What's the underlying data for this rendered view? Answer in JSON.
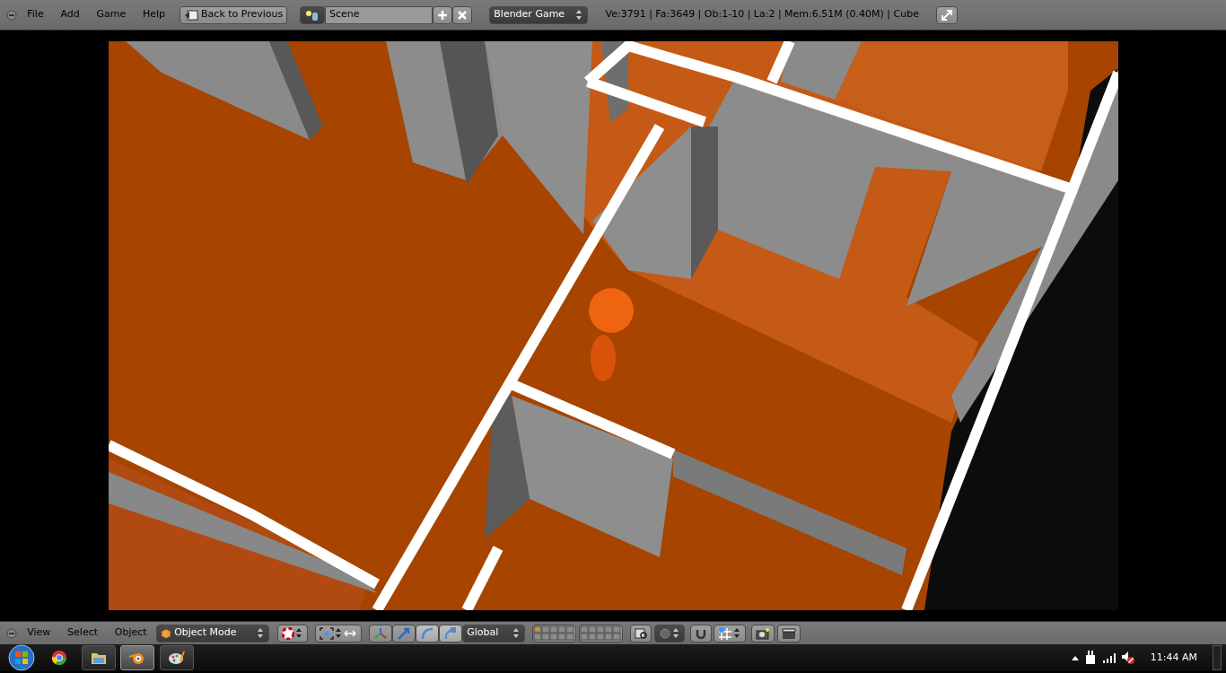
{
  "top_bar": {
    "menus": [
      "File",
      "Add",
      "Game",
      "Help"
    ],
    "back_button": "Back to Previous",
    "scene_field": "Scene",
    "render_engine": "Blender Game",
    "stats": "Ve:3791 | Fa:3649 | Ob:1-10 | La:2 | Mem:6.51M (0.40M) | Cube"
  },
  "bottom_bar": {
    "menus": [
      "View",
      "Select",
      "Object"
    ],
    "mode": "Object Mode",
    "manipulators": [
      {
        "kind": "axes",
        "pressed": false
      },
      {
        "kind": "translate",
        "pressed": false
      },
      {
        "kind": "rotate",
        "pressed": true
      },
      {
        "kind": "scale",
        "pressed": true
      }
    ],
    "orientation": "Global"
  },
  "taskbar": {
    "apps": [
      {
        "kind": "browser",
        "selected": false
      },
      {
        "kind": "folder",
        "selected": false
      },
      {
        "kind": "blender",
        "selected": true
      },
      {
        "kind": "paint",
        "selected": false
      }
    ],
    "clock": "11:44 AM"
  }
}
